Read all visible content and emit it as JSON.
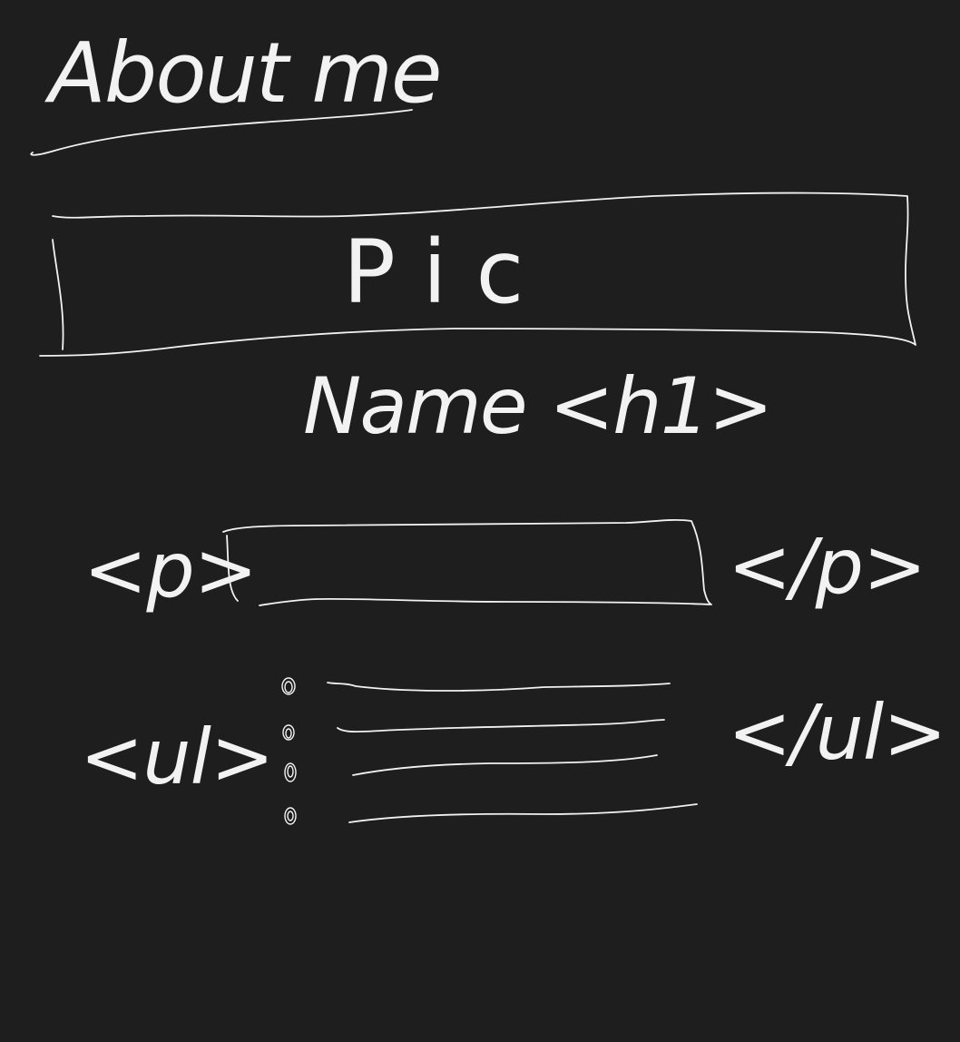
{
  "sketch": {
    "heading": "About me",
    "picture_label": "Pic",
    "name_label": "Name <h1>",
    "paragraph_open_tag": "<p>",
    "paragraph_close_tag": "</p>",
    "list_open_tag": "<ul>",
    "list_close_tag": "</ul>",
    "list_item_count": 4
  },
  "colors": {
    "background": "#1e1e1e",
    "ink": "#f2f2f2"
  }
}
